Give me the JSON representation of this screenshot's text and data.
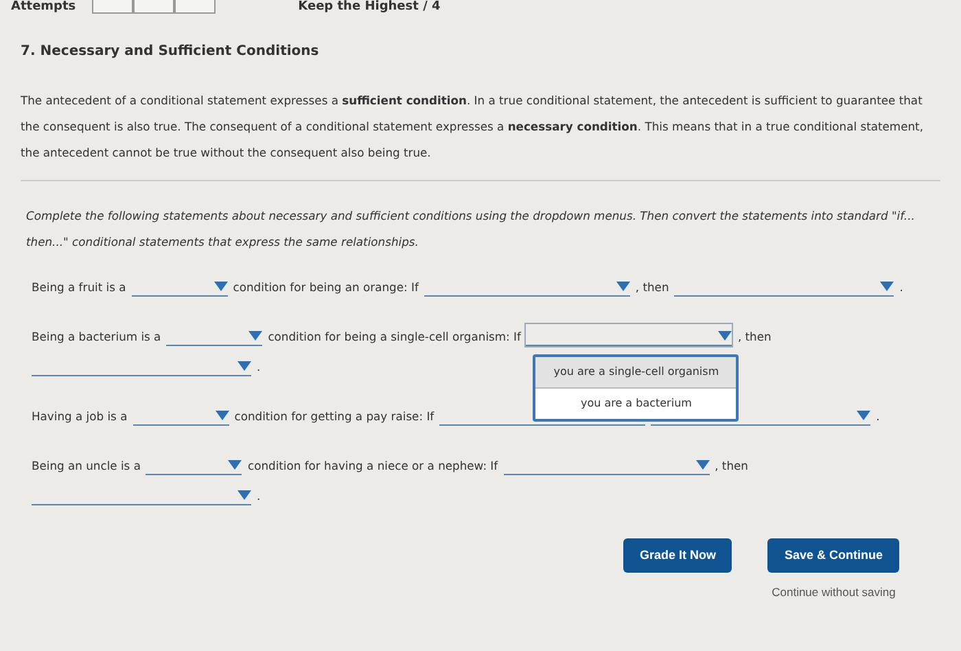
{
  "header": {
    "attempts_label": "Attempts",
    "keep_label": "Keep the Highest / 4"
  },
  "question": {
    "title": "7. Necessary and Sufficient Conditions",
    "intro": "The antecedent of a conditional statement expresses a **sufficient condition**. In a true conditional statement, the antecedent is sufficient to guarantee that the consequent is also true. The consequent of a conditional statement expresses a **necessary condition**. This means that in a true conditional statement, the antecedent cannot be true without the consequent also being true.",
    "instructions": "Complete the following statements about necessary and sufficient conditions using the dropdown menus. Then convert the statements into standard \"if... then...\" conditional statements that express the same relationships."
  },
  "statements": [
    {
      "segments": [
        {
          "kind": "text",
          "text": "Being a fruit is a"
        },
        {
          "kind": "select",
          "expanded": false
        },
        {
          "kind": "text",
          "text": "condition for being an orange: If"
        },
        {
          "kind": "select",
          "expanded": false
        },
        {
          "kind": "text",
          "text": ", then"
        },
        {
          "kind": "select",
          "expanded": false
        },
        {
          "kind": "text",
          "text": "."
        }
      ]
    },
    {
      "segments": [
        {
          "kind": "text",
          "text": "Being a bacterium is a"
        },
        {
          "kind": "select",
          "expanded": false
        },
        {
          "kind": "text",
          "text": "condition for being a single-cell organism: If"
        },
        {
          "kind": "select",
          "expanded": true,
          "options": [
            {
              "label": "you are a single-cell organism",
              "selected": true
            },
            {
              "label": "you are a bacterium",
              "selected": false
            }
          ]
        },
        {
          "kind": "text",
          "text": ", then"
        },
        {
          "kind": "select",
          "expanded": false
        },
        {
          "kind": "text",
          "text": "."
        }
      ]
    },
    {
      "segments": [
        {
          "kind": "text",
          "text": "Having a job is a"
        },
        {
          "kind": "select",
          "expanded": false
        },
        {
          "kind": "text",
          "text": "condition for getting a pay raise: If"
        },
        {
          "kind": "select",
          "expanded": false
        },
        {
          "kind": "select",
          "expanded": false
        },
        {
          "kind": "text",
          "text": "."
        }
      ]
    },
    {
      "segments": [
        {
          "kind": "text",
          "text": "Being an uncle is a"
        },
        {
          "kind": "select",
          "expanded": false
        },
        {
          "kind": "text",
          "text": "condition for having a niece or a nephew: If"
        },
        {
          "kind": "select",
          "expanded": false
        },
        {
          "kind": "text",
          "text": ", then"
        },
        {
          "kind": "select",
          "expanded": false
        },
        {
          "kind": "text",
          "text": "."
        }
      ]
    }
  ],
  "buttons": [
    {
      "label": "Grade It Now"
    },
    {
      "label": "Save & Continue"
    }
  ],
  "link": "Continue without saving"
}
